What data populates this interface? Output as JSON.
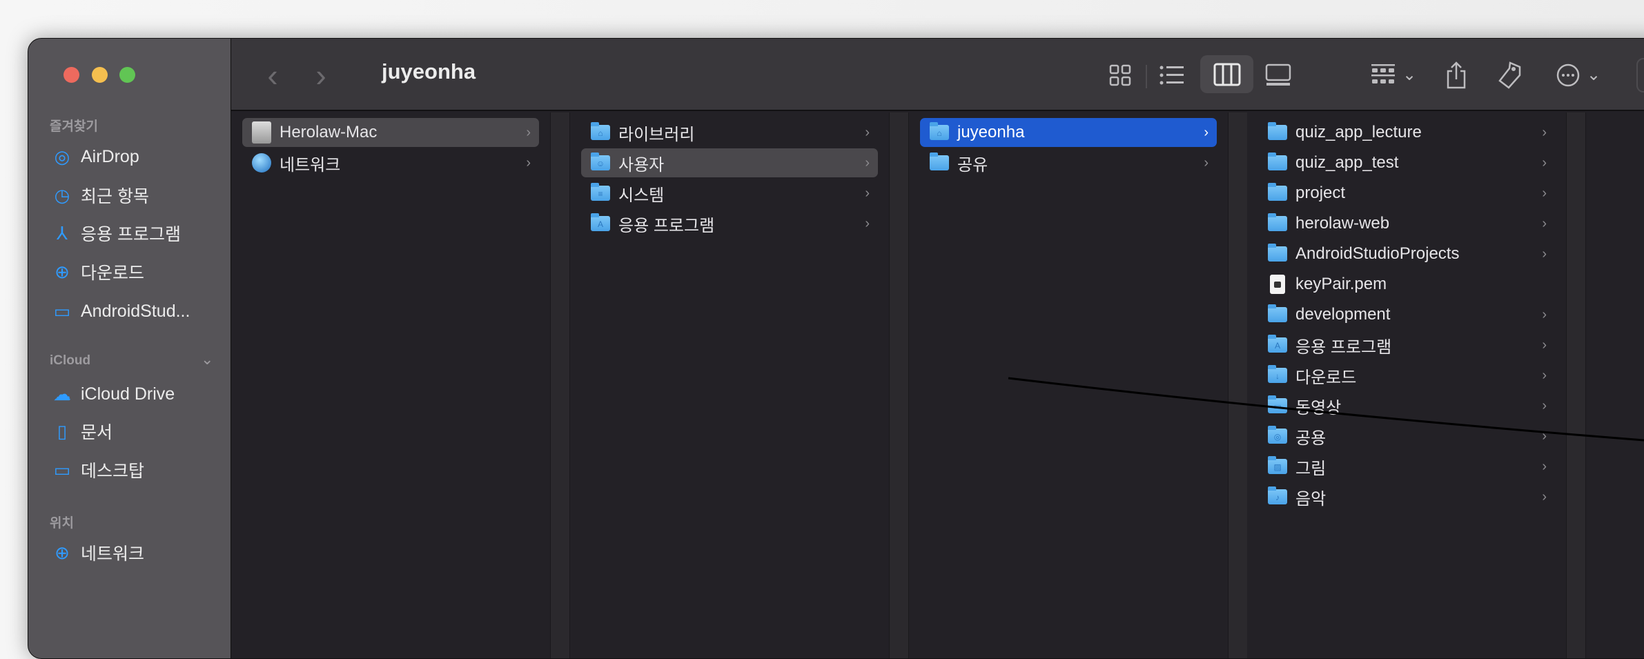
{
  "window": {
    "title": "juyeonha"
  },
  "sidebar": {
    "favorites_label": "즐겨찾기",
    "favorites": [
      {
        "label": "AirDrop",
        "icon": "airdrop-icon"
      },
      {
        "label": "최근 항목",
        "icon": "clock-icon"
      },
      {
        "label": "응용 프로그램",
        "icon": "apps-icon"
      },
      {
        "label": "다운로드",
        "icon": "download-icon"
      },
      {
        "label": "AndroidStud...",
        "icon": "folder-icon"
      }
    ],
    "icloud_label": "iCloud",
    "icloud": [
      {
        "label": "iCloud Drive",
        "icon": "cloud-icon"
      },
      {
        "label": "문서",
        "icon": "document-icon"
      },
      {
        "label": "데스크탑",
        "icon": "desktop-icon"
      }
    ],
    "locations_label": "위치",
    "locations": [
      {
        "label": "네트워크",
        "icon": "globe-icon"
      }
    ]
  },
  "columns": [
    [
      {
        "label": "Herolaw-Mac",
        "type": "drive",
        "state": "sel"
      },
      {
        "label": "네트워크",
        "type": "globe"
      }
    ],
    [
      {
        "label": "라이브러리",
        "type": "folder",
        "glyph": "⌂"
      },
      {
        "label": "사용자",
        "type": "folder",
        "glyph": "☺",
        "state": "sel"
      },
      {
        "label": "시스템",
        "type": "folder",
        "glyph": "≡"
      },
      {
        "label": "응용 프로그램",
        "type": "folder",
        "glyph": "A"
      }
    ],
    [
      {
        "label": "juyeonha",
        "type": "folder",
        "glyph": "⌂",
        "state": "act"
      },
      {
        "label": "공유",
        "type": "folder"
      }
    ],
    [
      {
        "label": "quiz_app_lecture",
        "type": "folder"
      },
      {
        "label": "quiz_app_test",
        "type": "folder"
      },
      {
        "label": "project",
        "type": "folder"
      },
      {
        "label": "herolaw-web",
        "type": "folder"
      },
      {
        "label": "AndroidStudioProjects",
        "type": "folder"
      },
      {
        "label": "keyPair.pem",
        "type": "file"
      },
      {
        "label": "development",
        "type": "folder"
      },
      {
        "label": "응용 프로그램",
        "type": "folder",
        "glyph": "A"
      },
      {
        "label": "다운로드",
        "type": "folder",
        "glyph": "↓"
      },
      {
        "label": "동영상",
        "type": "folder",
        "glyph": "▭"
      },
      {
        "label": "공용",
        "type": "folder",
        "glyph": "◎"
      },
      {
        "label": "그림",
        "type": "folder",
        "glyph": "▨"
      },
      {
        "label": "음악",
        "type": "folder",
        "glyph": "♪"
      }
    ]
  ],
  "glyphs": {
    "back": "‹",
    "forward": "›",
    "chev": "›",
    "down": "⌄",
    "more": "⋯"
  }
}
